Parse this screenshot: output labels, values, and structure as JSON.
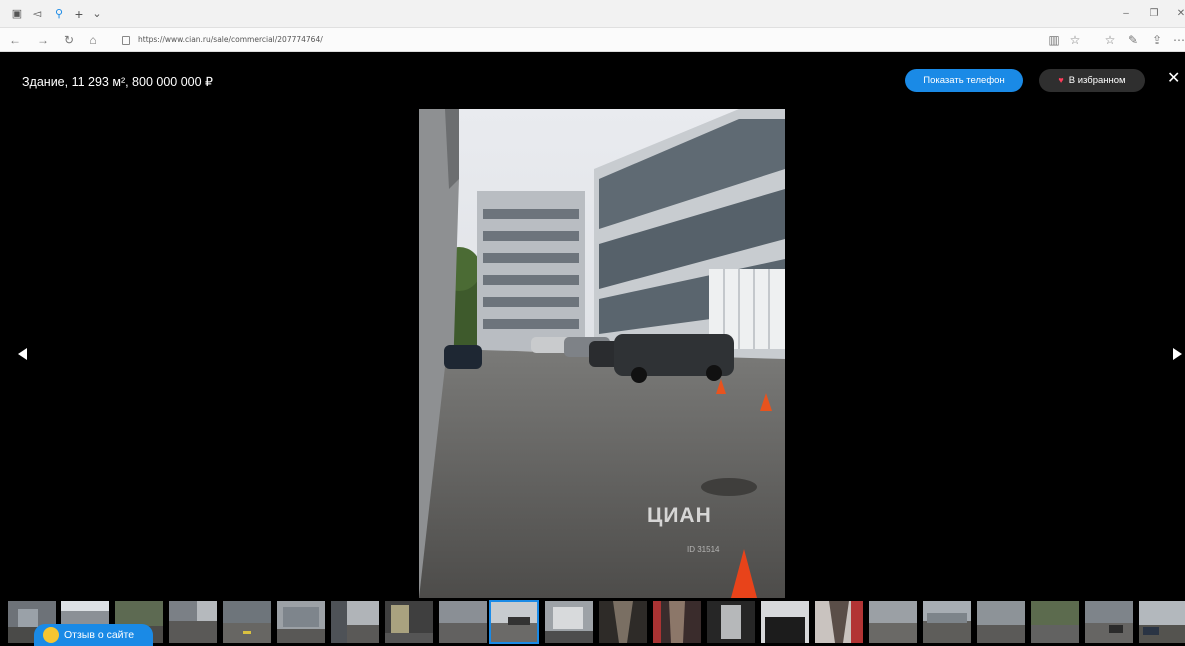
{
  "browser": {
    "url": "https://www.cian.ru/sale/commercial/207774764/",
    "tab_icons": [
      "tab-preview-icon",
      "tab-back-icon",
      "location-pin-icon",
      "new-tab-icon",
      "tab-list-icon"
    ],
    "toolbar_icons": [
      "reading-view-icon",
      "favorite-star-icon",
      "favorites-list-icon",
      "pen-icon",
      "share-icon",
      "more-icon"
    ]
  },
  "gallery": {
    "title": "Здание, 11 293 м², 800 000 000 ₽",
    "show_phone_label": "Показать телефон",
    "favorites_label": "В избранном",
    "close_symbol": "✕",
    "watermark": "ЦИАН",
    "watermark_id": "ID 31514",
    "active_thumbnail": 9,
    "thumbnail_count": 22
  },
  "feedback": {
    "label": "Отзыв о сайте"
  },
  "colors": {
    "accent": "#1a8ae6",
    "heart": "#ff3c5a",
    "background": "#000000"
  }
}
